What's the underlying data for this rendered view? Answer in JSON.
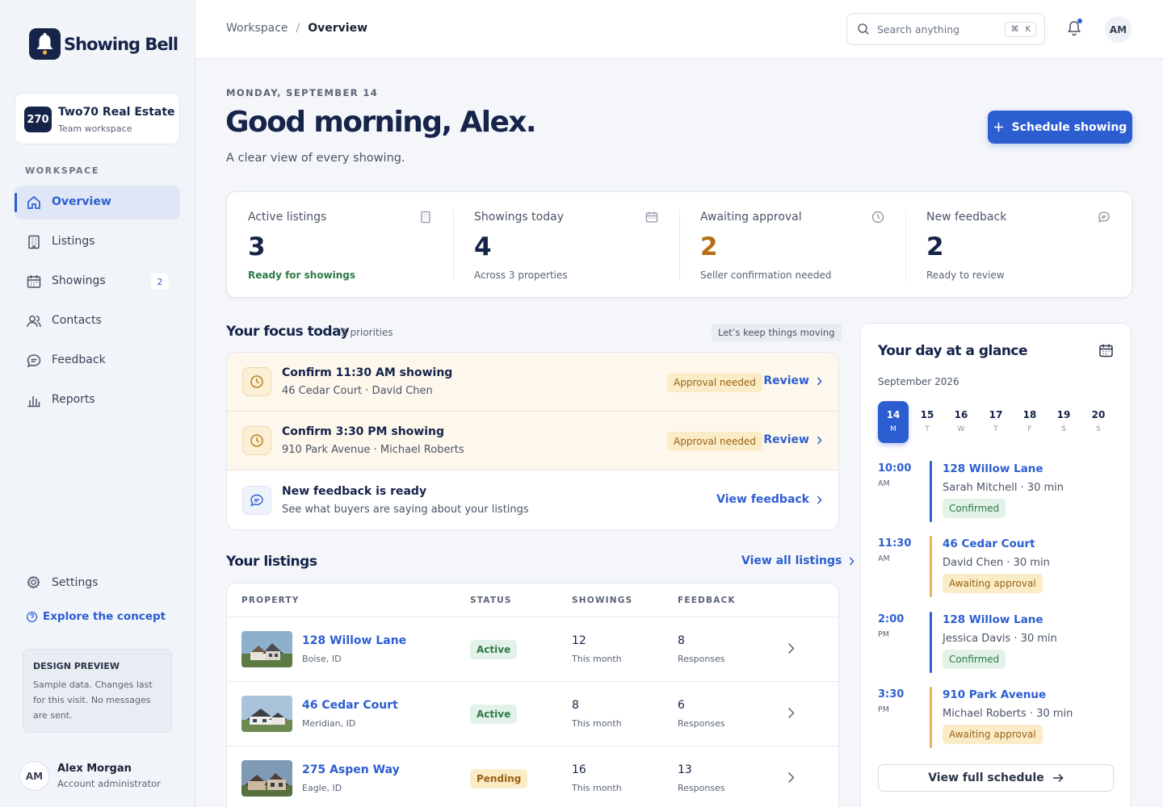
{
  "brand": {
    "name": "Showing Bell"
  },
  "workspace": {
    "badge": "270",
    "name": "Two70 Real Estate",
    "type": "Team workspace"
  },
  "sidebar": {
    "heading": "WORKSPACE",
    "items": [
      {
        "label": "Overview",
        "icon": "home-icon",
        "active": true
      },
      {
        "label": "Listings",
        "icon": "building-icon"
      },
      {
        "label": "Showings",
        "icon": "calendar-icon",
        "count": "2"
      },
      {
        "label": "Contacts",
        "icon": "users-icon"
      },
      {
        "label": "Feedback",
        "icon": "chat-icon"
      },
      {
        "label": "Reports",
        "icon": "bar-chart-icon"
      }
    ],
    "settings": "Settings",
    "explore": "Explore the concept",
    "preview": {
      "title": "DESIGN PREVIEW",
      "body": "Sample data. Changes last for this visit. No messages are sent."
    },
    "user": {
      "initials": "AM",
      "name": "Alex Morgan",
      "role": "Account administrator"
    }
  },
  "topbar": {
    "breadcrumb": [
      "Workspace",
      "Overview"
    ],
    "search_placeholder": "Search anything",
    "shortcut": [
      "⌘",
      "K"
    ],
    "avatar": "AM"
  },
  "header": {
    "date": "MONDAY, SEPTEMBER 14",
    "greeting": "Good morning, Alex.",
    "tagline": "A clear view of every showing.",
    "cta": "Schedule showing"
  },
  "stats": [
    {
      "label": "Active listings",
      "value": "3",
      "note": "Ready for showings",
      "icon": "building-icon"
    },
    {
      "label": "Showings today",
      "value": "4",
      "note": "Across 3 properties",
      "icon": "calendar-icon"
    },
    {
      "label": "Awaiting approval",
      "value": "2",
      "note": "Seller confirmation needed",
      "icon": "clock-icon"
    },
    {
      "label": "New feedback",
      "value": "2",
      "note": "Ready to review",
      "icon": "chat-icon"
    }
  ],
  "focus": {
    "title": "Your focus today",
    "count": "3 priorities",
    "pill": "Let’s keep things moving",
    "items": [
      {
        "title": "Confirm 11:30 AM showing",
        "sub": "46 Cedar Court · David Chen",
        "badge": "Approval needed",
        "action": "Review"
      },
      {
        "title": "Confirm 3:30 PM showing",
        "sub": "910 Park Avenue · Michael Roberts",
        "badge": "Approval needed",
        "action": "Review"
      },
      {
        "title": "New feedback is ready",
        "sub": "See what buyers are saying about your listings",
        "action": "View feedback"
      }
    ]
  },
  "listings": {
    "title": "Your listings",
    "link": "View all listings",
    "columns": [
      "PROPERTY",
      "STATUS",
      "SHOWINGS",
      "FEEDBACK"
    ],
    "rows": [
      {
        "name": "128 Willow Lane",
        "city": "Boise, ID",
        "status": "Active",
        "showings": "12",
        "showings_sub": "This month",
        "feedback": "8",
        "feedback_sub": "Responses"
      },
      {
        "name": "46 Cedar Court",
        "city": "Meridian, ID",
        "status": "Active",
        "showings": "8",
        "showings_sub": "This month",
        "feedback": "6",
        "feedback_sub": "Responses"
      },
      {
        "name": "275 Aspen Way",
        "city": "Eagle, ID",
        "status": "Pending",
        "showings": "16",
        "showings_sub": "This month",
        "feedback": "13",
        "feedback_sub": "Responses"
      }
    ]
  },
  "day": {
    "title": "Your day at a glance",
    "month": "September 2026",
    "days": [
      {
        "n": "14",
        "l": "M",
        "selected": true
      },
      {
        "n": "15",
        "l": "T"
      },
      {
        "n": "16",
        "l": "W"
      },
      {
        "n": "17",
        "l": "T"
      },
      {
        "n": "18",
        "l": "F"
      },
      {
        "n": "19",
        "l": "S"
      },
      {
        "n": "20",
        "l": "S"
      }
    ],
    "appointments": [
      {
        "time": "10:00",
        "ampm": "AM",
        "address": "128 Willow Lane",
        "detail": "Sarah Mitchell · 30 min",
        "status": "Confirmed"
      },
      {
        "time": "11:30",
        "ampm": "AM",
        "address": "46 Cedar Court",
        "detail": "David Chen · 30 min",
        "status": "Awaiting approval"
      },
      {
        "time": "2:00",
        "ampm": "PM",
        "address": "128 Willow Lane",
        "detail": "Jessica Davis · 30 min",
        "status": "Confirmed"
      },
      {
        "time": "3:30",
        "ampm": "PM",
        "address": "910 Park Avenue",
        "detail": "Michael Roberts · 30 min",
        "status": "Awaiting approval"
      }
    ],
    "button": "View full schedule"
  }
}
